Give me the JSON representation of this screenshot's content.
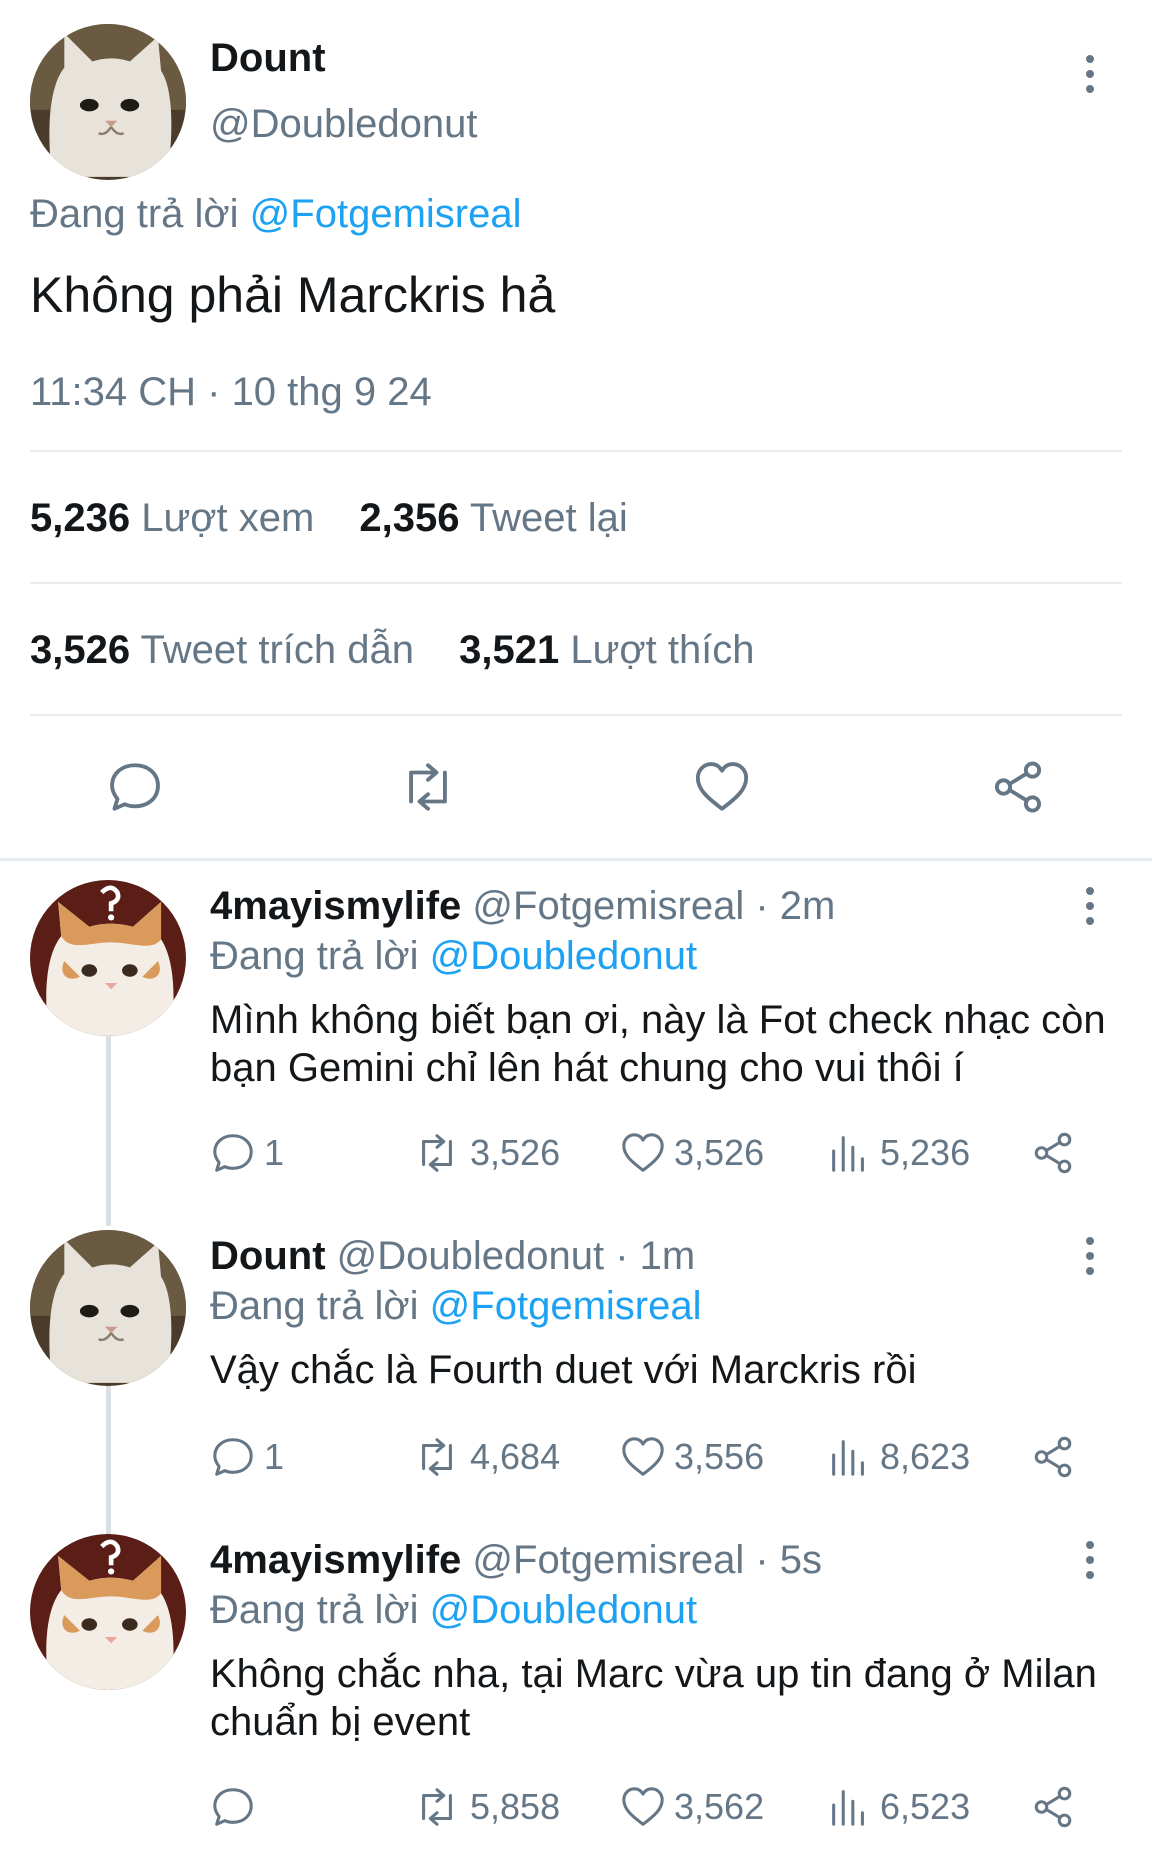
{
  "colors": {
    "link": "#1da1f2",
    "muted": "#657786",
    "text": "#14171a",
    "divider": "#e6ecf0"
  },
  "main_tweet": {
    "display_name": "Dount",
    "handle": "@Doubledonut",
    "replying_prefix": "Đang trả lời",
    "replying_to": "@Fotgemisreal",
    "text": "Không phải Marckris hả",
    "timestamp": "11:34 CH · 10 thg 9 24",
    "stats": {
      "views_count": "5,236",
      "views_label": "Lượt xem",
      "retweets_count": "2,356",
      "retweets_label": "Tweet lại",
      "quotes_count": "3,526",
      "quotes_label": "Tweet trích dẫn",
      "likes_count": "3,521",
      "likes_label": "Lượt thích"
    },
    "actions": [
      "reply-icon",
      "retweet-icon",
      "like-icon",
      "share-icon"
    ]
  },
  "replies": [
    {
      "display_name": "4mayismylife",
      "handle": "@Fotgemisreal",
      "time": "· 2m",
      "replying_prefix": "Đang trả lời",
      "replying_to": "@Doubledonut",
      "text": "Mình không biết bạn ơi, này là Fot check nhạc còn bạn Gemini chỉ lên hát chung cho vui thôi í",
      "replies": "1",
      "retweets": "3,526",
      "likes": "3,526",
      "views": "5,236"
    },
    {
      "display_name": "Dount",
      "handle": "@Doubledonut",
      "time": "· 1m",
      "replying_prefix": "Đang trả lời",
      "replying_to": "@Fotgemisreal",
      "text": "Vậy chắc là Fourth duet với Marckris rồi",
      "replies": "1",
      "retweets": "4,684",
      "likes": "3,556",
      "views": "8,623"
    },
    {
      "display_name": "4mayismylife",
      "handle": "@Fotgemisreal",
      "time": "· 5s",
      "replying_prefix": "Đang trả lời",
      "replying_to": "@Doubledonut",
      "text": "Không chắc nha, tại Marc vừa up tin đang ở Milan chuẩn bị event",
      "replies": "",
      "retweets": "5,858",
      "likes": "3,562",
      "views": "6,523"
    }
  ]
}
